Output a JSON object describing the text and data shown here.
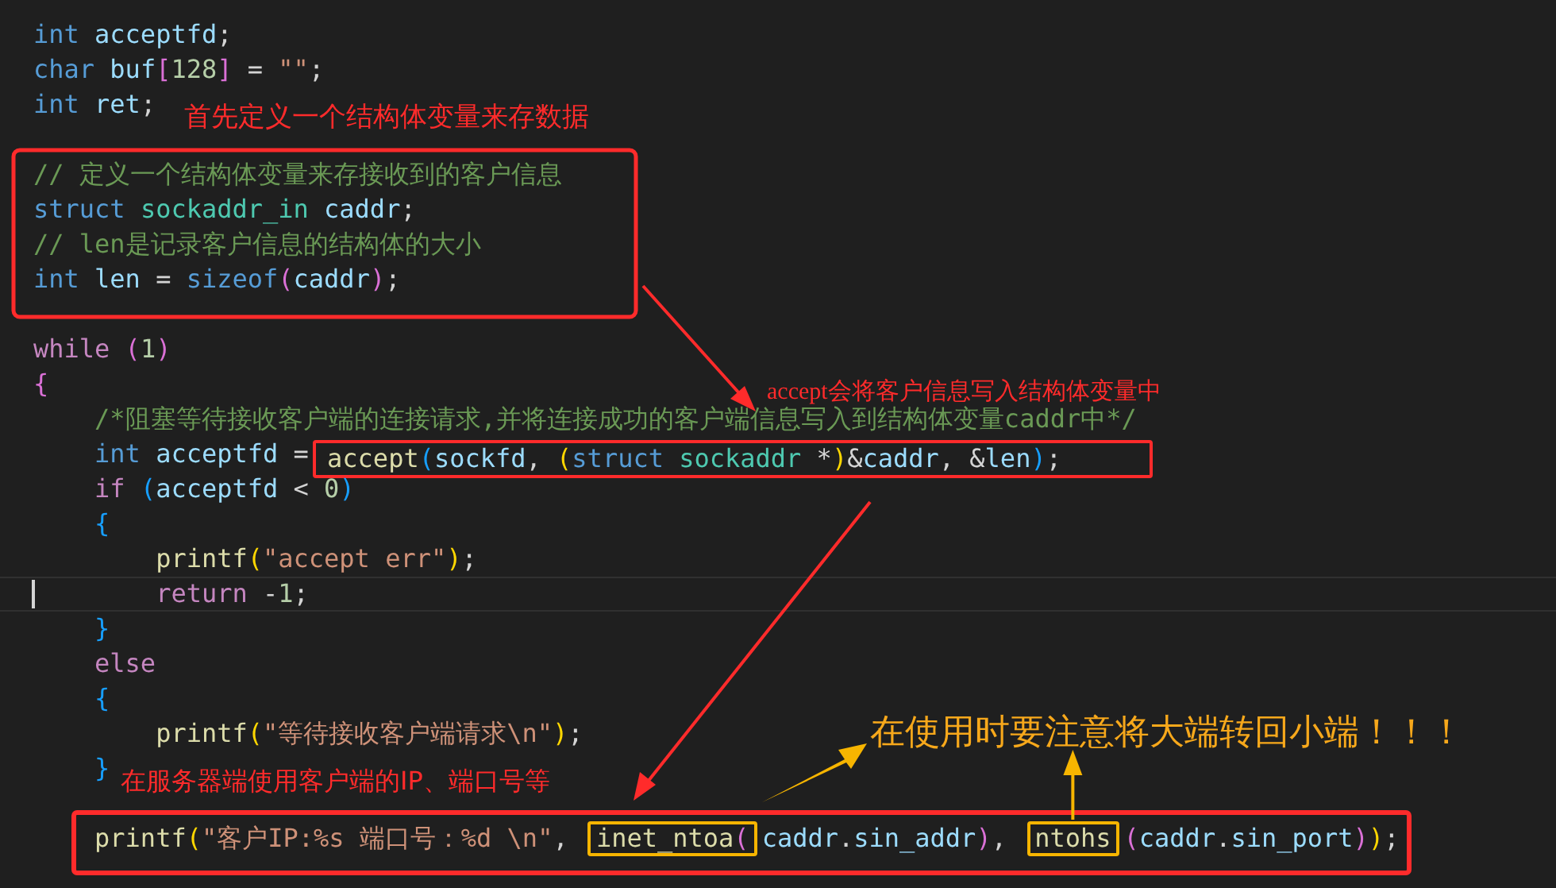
{
  "editor": {
    "lines": [
      {
        "current": false,
        "tokens": [
          {
            "kind": "kw",
            "text": "int "
          },
          {
            "kind": "id",
            "text": "acceptfd"
          },
          {
            "kind": "op",
            "text": ";"
          }
        ]
      },
      {
        "current": false,
        "tokens": [
          {
            "kind": "kw",
            "text": "char "
          },
          {
            "kind": "id",
            "text": "buf"
          },
          {
            "kind": "b2",
            "text": "["
          },
          {
            "kind": "num",
            "text": "128"
          },
          {
            "kind": "b2",
            "text": "]"
          },
          {
            "kind": "op",
            "text": " = "
          },
          {
            "kind": "str",
            "text": "\"\""
          },
          {
            "kind": "op",
            "text": ";"
          }
        ]
      },
      {
        "current": false,
        "tokens": [
          {
            "kind": "kw",
            "text": "int "
          },
          {
            "kind": "id",
            "text": "ret"
          },
          {
            "kind": "op",
            "text": ";"
          }
        ]
      },
      {
        "current": false
      },
      {
        "current": false,
        "tokens": [
          {
            "kind": "com",
            "text": "// 定义一个结构体变量来存接收到的客户信息"
          }
        ]
      },
      {
        "current": false,
        "tokens": [
          {
            "kind": "kw",
            "text": "struct "
          },
          {
            "kind": "type",
            "text": "sockaddr_in "
          },
          {
            "kind": "id",
            "text": "caddr"
          },
          {
            "kind": "op",
            "text": ";"
          }
        ]
      },
      {
        "current": false,
        "tokens": [
          {
            "kind": "com",
            "text": "// len是记录客户信息的结构体的大小"
          }
        ]
      },
      {
        "current": false,
        "tokens": [
          {
            "kind": "kw",
            "text": "int "
          },
          {
            "kind": "id",
            "text": "len"
          },
          {
            "kind": "op",
            "text": " = "
          },
          {
            "kind": "kw",
            "text": "sizeof"
          },
          {
            "kind": "b2",
            "text": "("
          },
          {
            "kind": "id",
            "text": "caddr"
          },
          {
            "kind": "b2",
            "text": ")"
          },
          {
            "kind": "op",
            "text": ";"
          }
        ]
      },
      {
        "current": false
      },
      {
        "current": false,
        "tokens": [
          {
            "kind": "ctl",
            "text": "while "
          },
          {
            "kind": "b2",
            "text": "("
          },
          {
            "kind": "num",
            "text": "1"
          },
          {
            "kind": "b2",
            "text": ")"
          }
        ]
      },
      {
        "current": false,
        "tokens": [
          {
            "kind": "b2",
            "text": "{"
          }
        ]
      },
      {
        "current": false,
        "tokens": [
          {
            "kind": "com",
            "text": "    /*阻塞等待接收客户端的连接请求,并将连接成功的客户端信息写入到结构体变量caddr中*/"
          }
        ]
      },
      {
        "current": false,
        "tokens": [
          {
            "kind": "kw",
            "text": "    int "
          },
          {
            "kind": "id",
            "text": "acceptfd"
          },
          {
            "kind": "op",
            "text": " = "
          },
          {
            "kind": "fn",
            "text": "accept"
          },
          {
            "kind": "b3",
            "text": "("
          },
          {
            "kind": "id",
            "text": "sockfd"
          },
          {
            "kind": "op",
            "text": ", "
          },
          {
            "kind": "b1",
            "text": "("
          },
          {
            "kind": "kw",
            "text": "struct "
          },
          {
            "kind": "type",
            "text": "sockaddr"
          },
          {
            "kind": "op",
            "text": " *"
          },
          {
            "kind": "b1",
            "text": ")"
          },
          {
            "kind": "op",
            "text": "&"
          },
          {
            "kind": "id",
            "text": "caddr"
          },
          {
            "kind": "op",
            "text": ", &"
          },
          {
            "kind": "id",
            "text": "len"
          },
          {
            "kind": "b3",
            "text": ")"
          },
          {
            "kind": "op",
            "text": ";"
          }
        ]
      },
      {
        "current": false,
        "tokens": [
          {
            "kind": "ctl",
            "text": "    if "
          },
          {
            "kind": "b3",
            "text": "("
          },
          {
            "kind": "id",
            "text": "acceptfd"
          },
          {
            "kind": "op",
            "text": " < "
          },
          {
            "kind": "num",
            "text": "0"
          },
          {
            "kind": "b3",
            "text": ")"
          }
        ]
      },
      {
        "current": false,
        "tokens": [
          {
            "kind": "b3",
            "text": "    {"
          }
        ]
      },
      {
        "current": false,
        "tokens": [
          {
            "kind": "fn",
            "text": "        printf"
          },
          {
            "kind": "b1",
            "text": "("
          },
          {
            "kind": "str",
            "text": "\"accept err\""
          },
          {
            "kind": "b1",
            "text": ")"
          },
          {
            "kind": "op",
            "text": ";"
          }
        ]
      },
      {
        "current": true,
        "tokens": [
          {
            "kind": "ctl",
            "text": "        return"
          },
          {
            "kind": "op",
            "text": " -"
          },
          {
            "kind": "num",
            "text": "1"
          },
          {
            "kind": "op",
            "text": ";"
          }
        ]
      },
      {
        "current": false,
        "tokens": [
          {
            "kind": "b3",
            "text": "    }"
          }
        ]
      },
      {
        "current": false,
        "tokens": [
          {
            "kind": "ctl",
            "text": "    else"
          }
        ]
      },
      {
        "current": false,
        "tokens": [
          {
            "kind": "b3",
            "text": "    {"
          }
        ]
      },
      {
        "current": false,
        "tokens": [
          {
            "kind": "fn",
            "text": "        printf"
          },
          {
            "kind": "b1",
            "text": "("
          },
          {
            "kind": "str",
            "text": "\"等待接收客户端请求\\n\""
          },
          {
            "kind": "b1",
            "text": ")"
          },
          {
            "kind": "op",
            "text": ";"
          }
        ]
      },
      {
        "current": false,
        "tokens": [
          {
            "kind": "b3",
            "text": "    }"
          }
        ]
      },
      {
        "current": false
      },
      {
        "current": false,
        "tokens": [
          {
            "kind": "fn",
            "text": "    printf"
          },
          {
            "kind": "b1",
            "text": "("
          },
          {
            "kind": "str",
            "text": "\"客户IP:%s 端口号：%d \\n\""
          },
          {
            "kind": "op",
            "text": ", "
          },
          {
            "kind": "fn",
            "text": "inet_ntoa"
          },
          {
            "kind": "b2",
            "text": "("
          },
          {
            "kind": "id",
            "text": "caddr"
          },
          {
            "kind": "op",
            "text": "."
          },
          {
            "kind": "id",
            "text": "sin_addr"
          },
          {
            "kind": "b2",
            "text": ")"
          },
          {
            "kind": "op",
            "text": ", "
          },
          {
            "kind": "fn",
            "text": "ntohs"
          },
          {
            "kind": "b2",
            "text": "("
          },
          {
            "kind": "id",
            "text": "caddr"
          },
          {
            "kind": "op",
            "text": "."
          },
          {
            "kind": "id",
            "text": "sin_port"
          },
          {
            "kind": "b2",
            "text": ")"
          },
          {
            "kind": "b1",
            "text": ")"
          },
          {
            "kind": "op",
            "text": ";"
          }
        ]
      }
    ]
  },
  "annotations": [
    {
      "text": "首先定义一个结构体变量来存数据",
      "color": "#ff2b2b"
    },
    {
      "text": "accept会将客户信息写入结构体变量中",
      "color": "#ff2b2b"
    },
    {
      "text": "在服务器端使用客户端的IP、端口号等",
      "color": "#ff2b2b"
    },
    {
      "text": "在使用时要注意将大端转回小端！！！",
      "color": "#f7a81b"
    }
  ]
}
